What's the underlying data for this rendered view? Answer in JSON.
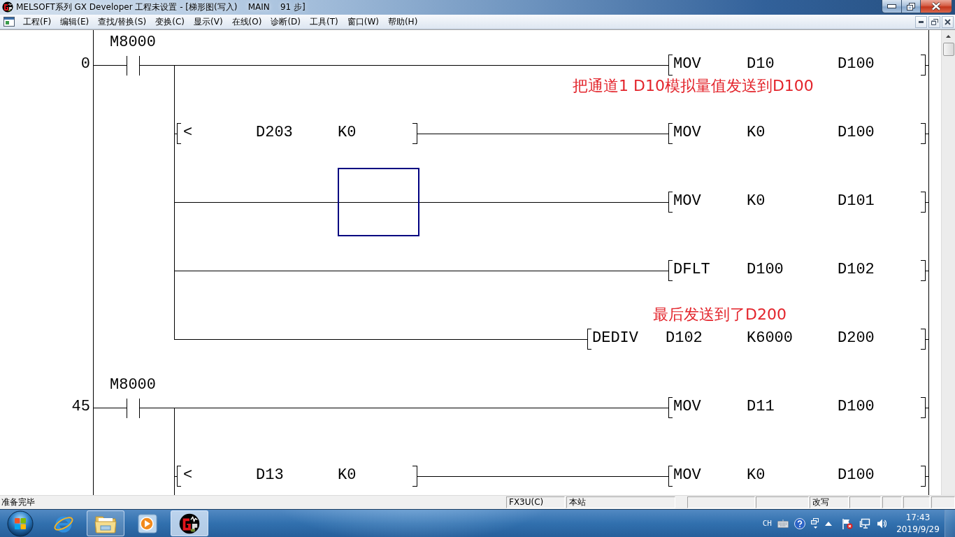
{
  "window": {
    "title": "MELSOFT系列 GX Developer 工程未设置 - [梯形图(写入)    MAIN    91 步]"
  },
  "menu": [
    "工程(F)",
    "编辑(E)",
    "查找/替换(S)",
    "变换(C)",
    "显示(V)",
    "在线(O)",
    "诊断(D)",
    "工具(T)",
    "窗口(W)",
    "帮助(H)"
  ],
  "ladder": {
    "blocks": [
      {
        "step": "0",
        "contact": {
          "kind": "normally-open",
          "device": "M8000"
        },
        "continues_below": false,
        "rungs": [
          {
            "instruction": {
              "name": "MOV",
              "operands": [
                "D10",
                "D100"
              ]
            },
            "note_below": "把通道1 D10模拟量值发送到D100",
            "selected": false
          },
          {
            "condition": {
              "kind": "compare",
              "operator": "<",
              "operands": [
                "D203",
                "K0"
              ]
            },
            "instruction": {
              "name": "MOV",
              "operands": [
                "K0",
                "D100"
              ]
            },
            "selected": false
          },
          {
            "instruction": {
              "name": "MOV",
              "operands": [
                "K0",
                "D101"
              ]
            },
            "selected": true
          },
          {
            "instruction": {
              "name": "DFLT",
              "operands": [
                "D100",
                "D102"
              ]
            },
            "selected": false
          },
          {
            "instruction": {
              "name": "DEDIV",
              "operands": [
                "D102",
                "K6000",
                "D200"
              ]
            },
            "note_above": "最后发送到了D200",
            "selected": false
          }
        ]
      },
      {
        "step": "45",
        "contact": {
          "kind": "normally-open",
          "device": "M8000"
        },
        "continues_below": true,
        "rungs": [
          {
            "instruction": {
              "name": "MOV",
              "operands": [
                "D11",
                "D100"
              ]
            },
            "selected": false
          },
          {
            "condition": {
              "kind": "compare",
              "operator": "<",
              "operands": [
                "D13",
                "K0"
              ]
            },
            "instruction": {
              "name": "MOV",
              "operands": [
                "K0",
                "D100"
              ]
            },
            "selected": false
          }
        ]
      }
    ]
  },
  "status_bar": {
    "message": "准备完毕",
    "panes": [
      "FX3U(C)",
      "本站",
      "改写"
    ]
  },
  "taskbar": {
    "apps": [
      {
        "kind": "browser",
        "running": false,
        "active": false
      },
      {
        "kind": "folder",
        "running": true,
        "active": false
      },
      {
        "kind": "media-player",
        "running": false,
        "active": false
      },
      {
        "kind": "plc-editor",
        "running": true,
        "active": true
      }
    ],
    "tray": {
      "language": "CH",
      "time": "17:43",
      "date": "2019/9/29"
    }
  }
}
